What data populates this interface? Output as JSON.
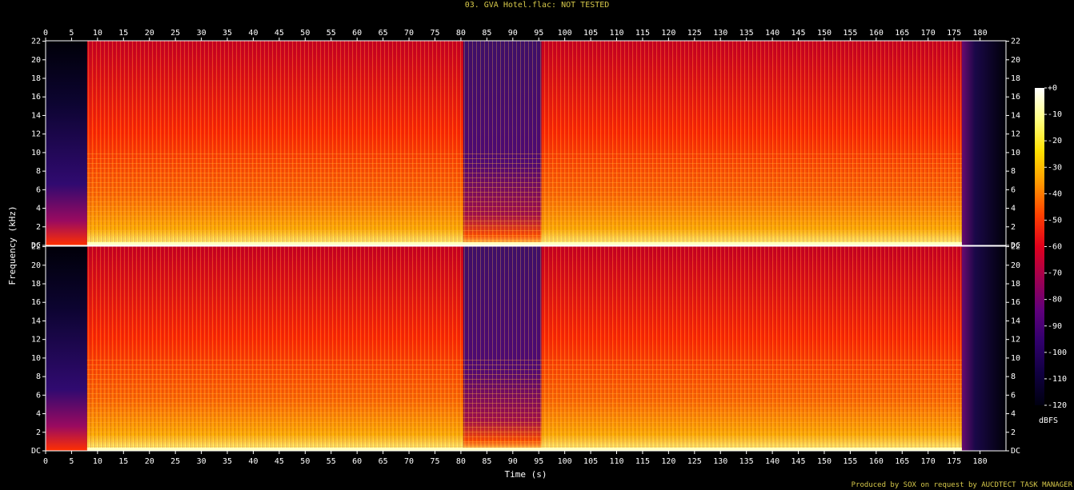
{
  "window": {
    "title": "03. GVA Hotel.flac: NOT TESTED"
  },
  "footer": {
    "credit": "Produced by SOX on request by AUCDTECT TASK MANAGER"
  },
  "chart_data": {
    "type": "heatmap",
    "title": "03. GVA Hotel.flac: NOT TESTED",
    "xlabel": "Time (s)",
    "ylabel": "Frequency (kHz)",
    "xlim": [
      0,
      185
    ],
    "ylim": [
      0,
      22.05
    ],
    "x_ticks": [
      0,
      5,
      10,
      15,
      20,
      25,
      30,
      35,
      40,
      45,
      50,
      55,
      60,
      65,
      70,
      75,
      80,
      85,
      90,
      95,
      100,
      105,
      110,
      115,
      120,
      125,
      130,
      135,
      140,
      145,
      150,
      155,
      160,
      165,
      170,
      175,
      180
    ],
    "y_ticks": [
      {
        "value": 0,
        "label": "DC"
      },
      {
        "value": 2,
        "label": "2"
      },
      {
        "value": 4,
        "label": "4"
      },
      {
        "value": 6,
        "label": "6"
      },
      {
        "value": 8,
        "label": "8"
      },
      {
        "value": 10,
        "label": "10"
      },
      {
        "value": 12,
        "label": "12"
      },
      {
        "value": 14,
        "label": "14"
      },
      {
        "value": 16,
        "label": "16"
      },
      {
        "value": 18,
        "label": "18"
      },
      {
        "value": 20,
        "label": "20"
      },
      {
        "value": 22,
        "label": "22"
      }
    ],
    "channels": 2,
    "colorbar": {
      "label": "dBFS",
      "range": [
        -120,
        0
      ],
      "ticks": [
        "+0",
        "-10",
        "-20",
        "-30",
        "-40",
        "-50",
        "-60",
        "-70",
        "-80",
        "-90",
        "-100",
        "-110",
        "-120"
      ],
      "colors": [
        "#ffffff",
        "#ffff80",
        "#ffe000",
        "#ff9800",
        "#ff4000",
        "#e0001c",
        "#a00050",
        "#60007c",
        "#30006c",
        "#100040",
        "#000010"
      ]
    },
    "segments": [
      {
        "start": 0,
        "end": 8,
        "level": "quiet"
      },
      {
        "start": 8,
        "end": 80.5,
        "level": "loud"
      },
      {
        "start": 80.5,
        "end": 95.5,
        "level": "mid"
      },
      {
        "start": 95.5,
        "end": 176.5,
        "level": "loud"
      },
      {
        "start": 176.5,
        "end": 185,
        "level": "fade"
      }
    ]
  }
}
